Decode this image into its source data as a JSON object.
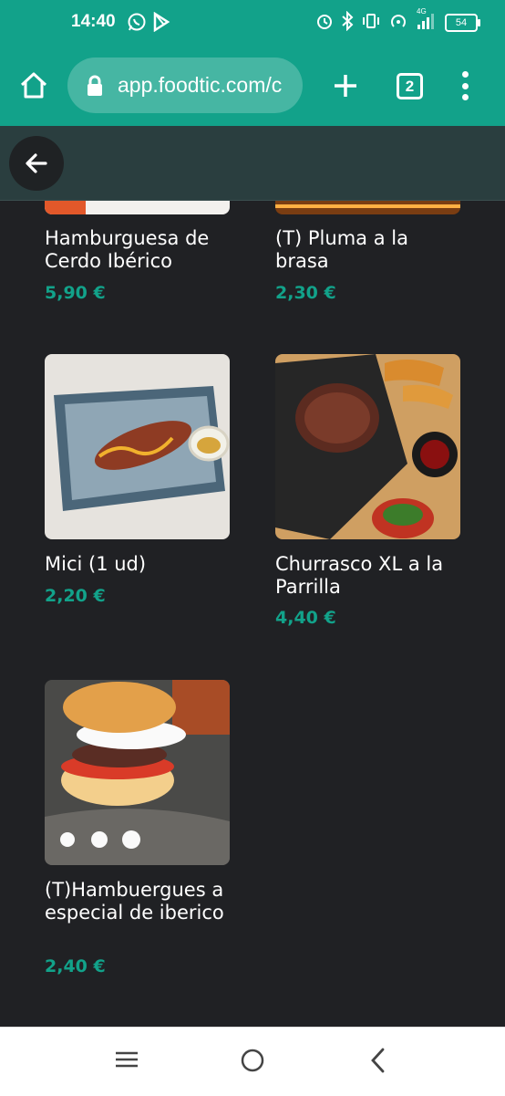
{
  "status_bar": {
    "time": "14:40",
    "left_icons": [
      "whatsapp-icon",
      "play-store-icon"
    ],
    "right_icons": [
      "alarm-icon",
      "bluetooth-icon",
      "vibrate-icon",
      "hotspot-icon",
      "signal-icon"
    ],
    "network": "4G",
    "battery": "54"
  },
  "browser": {
    "url": "app.foodtic.com/c",
    "tab_count": "2",
    "theme_color": "#12a28a"
  },
  "colors": {
    "accent": "#12a28a",
    "background": "#202124",
    "appbar": "#2a3e3f"
  },
  "products": [
    {
      "name": "Hamburguesa de Cerdo Ibérico",
      "price": "5,90 €"
    },
    {
      "name": "(T) Pluma a la brasa",
      "price": "2,30 €"
    },
    {
      "name": "Mici (1 ud)",
      "price": "2,20 €"
    },
    {
      "name": "Churrasco XL a la Parrilla",
      "price": "4,40 €"
    },
    {
      "name": "(T)Hambuergues a especial de iberico",
      "price": "2,40 €"
    }
  ],
  "nav_bar": [
    "recents-icon",
    "home-circle-icon",
    "back-chevron-icon"
  ]
}
